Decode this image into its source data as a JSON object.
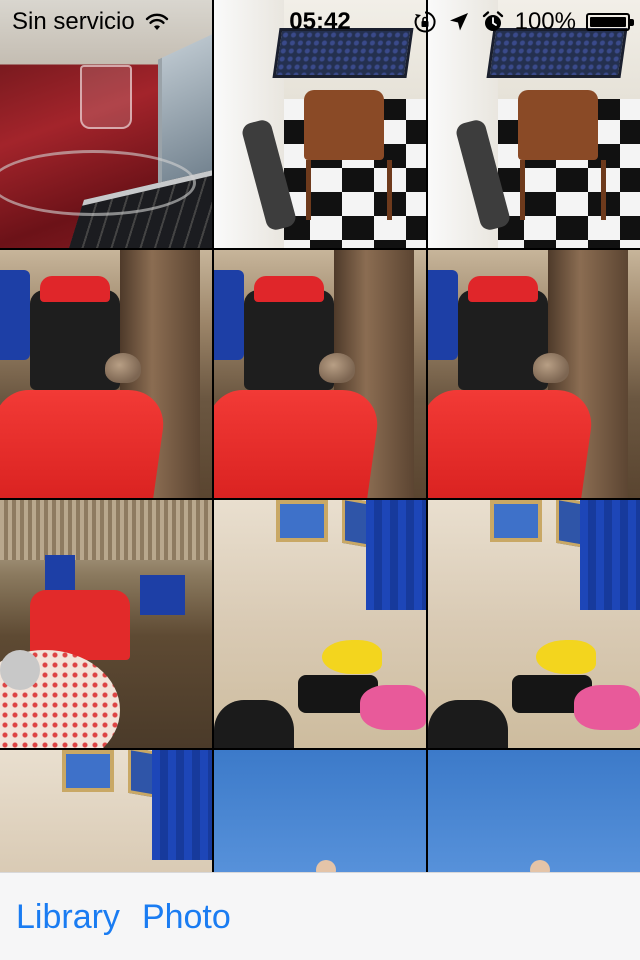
{
  "status_bar": {
    "carrier": "Sin servicio",
    "time": "05:42",
    "battery_percent": "100%",
    "battery_level": 1.0,
    "icons": [
      "wifi-icon",
      "rotation-lock-icon",
      "location-arrow-icon",
      "alarm-clock-icon",
      "battery-icon"
    ]
  },
  "photo_grid": {
    "columns": 3,
    "photos": [
      {
        "name": "photo-laptop-table",
        "scene": "laptop"
      },
      {
        "name": "photo-checkered-floor-1",
        "scene": "checker"
      },
      {
        "name": "photo-checkered-floor-2",
        "scene": "checker"
      },
      {
        "name": "photo-sparrow-1",
        "scene": "sparrow"
      },
      {
        "name": "photo-sparrow-2",
        "scene": "sparrow"
      },
      {
        "name": "photo-sparrow-3",
        "scene": "sparrow"
      },
      {
        "name": "photo-cafe-garden",
        "scene": "garden"
      },
      {
        "name": "photo-room-bags-1",
        "scene": "room"
      },
      {
        "name": "photo-room-bags-2",
        "scene": "room"
      },
      {
        "name": "photo-room-partial",
        "scene": "room"
      },
      {
        "name": "photo-sky-sea-1",
        "scene": "sea"
      },
      {
        "name": "photo-sky-sea-2",
        "scene": "sea"
      }
    ]
  },
  "bottom_bar": {
    "library_label": "Library",
    "photo_label": "Photo"
  },
  "colors": {
    "accent": "#1a7cf2",
    "bottom_bar_bg": "#f6f6f7"
  }
}
